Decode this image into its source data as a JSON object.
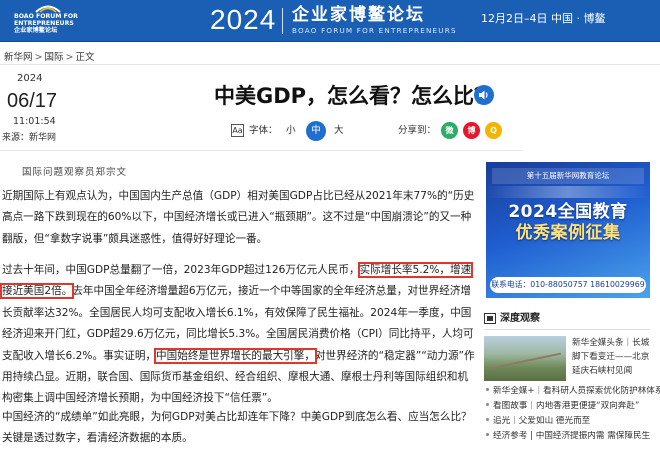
{
  "banner": {
    "logo_text_line1": "BOAO FORUM FOR",
    "logo_text_line2": "ENTREPRENEURS",
    "logo_text_line3": "企业家博鳌论坛",
    "year": "2024",
    "cn_title": "企业家博鳌论坛",
    "en_title": "BOAO FORUM FOR ENTREPRENEURS",
    "date": "12月2日–4日  中国 · 博鳌",
    "bg_color": "#1a5fb4"
  },
  "breadcrumb": {
    "items": [
      "新华网",
      "国际",
      "正文"
    ],
    "separator": ">"
  },
  "meta": {
    "year": "2024",
    "date": "06/17",
    "time": "11:01:54",
    "source_label": "来源：",
    "source": "新华网"
  },
  "article": {
    "title": "中美GDP，怎么看？怎么比？",
    "byline": "国际问题观察员郑宗文",
    "p1": "近期国际上有观点认为，中国国内生产总值（GDP）相对美国GDP占比已经从2021年末77%的“历史高点一路下跌到现在的60%以下，中国经济增长或已进入“瓶颈期”。这不过是“中国崩溃论”的又一种翻版，但“拿数字说事”颇具迷惑性，值得好好理论一番。",
    "p2_a": "过去十年间，中国GDP总量翻了一倍，2023年GDP超过126万亿元人民币，",
    "p2_hl1": "实际增长率5.2%，增速接近美国2倍。",
    "p2_b": "去年中国全年经济增量超6万亿元，接近一个中等国家的全年经济总量，对世界经济增长贡献率达32%。全国居民人均可支配收入增长6.1%，有效保障了民生福祉。2024年一季度，中国经济迎来开门红，GDP超29.6万亿元，同比增长5.3%。全国居民消费价格（CPI）同比持平，人均可支配收入增长6.2%。事实证明，",
    "p2_hl2": "中国始终是世界增长的最大引擎，",
    "p2_c": "对世界经济的“稳定器”“动力源”作用持续凸显。近期，联合国、国际货币基金组织、经合组织、摩根大通、摩根士丹利等国际组织和机构密集上调中国经济增长预期，为中国经济投下“信任票”。",
    "p3": "中国经济的“成绩单”如此亮眼，为何GDP对美占比却连年下降？中美GDP到底怎么看、应当怎么比？关键是透过数字，看清经济数据的本质。"
  },
  "tools": {
    "font_icon": "Aa",
    "font_label": "字体：",
    "size_small": "小",
    "size_mid": "中",
    "size_big": "大",
    "share_label": "分享到：",
    "share_wechat": "微",
    "share_weibo": "博",
    "share_qzone": "Q"
  },
  "ad": {
    "top": "第十五届新华网教育论坛",
    "main1": "2024全国教育",
    "main2": "优秀案例征集",
    "phone": "联系电话：010-88050757  18610029969"
  },
  "sidebar": {
    "deep_title": "深度观察",
    "deep_caption": "新华全媒头条｜长城脚下看变迁——北京延庆石峡村见闻",
    "news": [
      "新华全媒+｜看科研人员探索优化防护林体系",
      "看图故事｜内地香港更便捷“双向奔赴”",
      "追光｜父爱如山 德光而至",
      "经济参考 | 中国经济提振内需 需保障民生"
    ]
  },
  "colors": {
    "accent": "#1f6fd1",
    "highlight_border": "#e0362c"
  }
}
